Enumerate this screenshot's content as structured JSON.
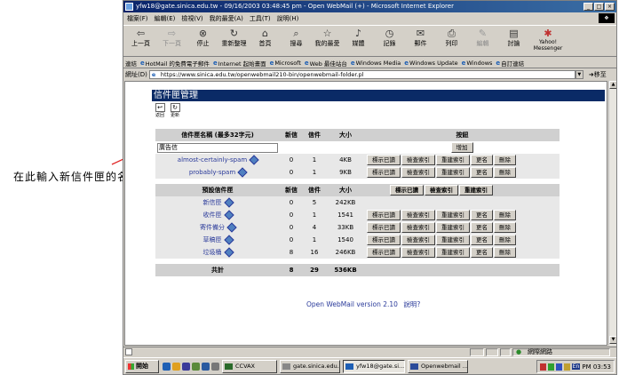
{
  "window": {
    "title": "yfw18@gate.sinica.edu.tw - 09/16/2003 03:48:45 pm - Open WebMail (+) - Microsoft Internet Explorer",
    "buttons": [
      "_",
      "□",
      "×"
    ]
  },
  "menu": [
    "檔案(F)",
    "編輯(E)",
    "檢視(V)",
    "我的最愛(A)",
    "工具(T)",
    "說明(H)"
  ],
  "toolbar": [
    {
      "label": "上一頁",
      "icon": "back-icon"
    },
    {
      "label": "下一頁",
      "icon": "forward-icon"
    },
    {
      "label": "停止",
      "icon": "stop-icon"
    },
    {
      "label": "重新整理",
      "icon": "refresh-icon"
    },
    {
      "label": "首頁",
      "icon": "home-icon"
    },
    {
      "label": "搜尋",
      "icon": "search-icon"
    },
    {
      "label": "我的最愛",
      "icon": "favorites-icon"
    },
    {
      "label": "媒體",
      "icon": "media-icon"
    },
    {
      "label": "記錄",
      "icon": "history-icon"
    },
    {
      "label": "郵件",
      "icon": "mail-icon"
    },
    {
      "label": "列印",
      "icon": "print-icon"
    },
    {
      "label": "編輯",
      "icon": "edit-icon"
    },
    {
      "label": "討論",
      "icon": "discuss-icon"
    },
    {
      "label": "Yahoo! Messenger",
      "icon": "messenger-icon"
    }
  ],
  "links_bar": {
    "label": "連結",
    "items": [
      "HotMail 的免費電子郵件",
      "Internet 起始畫面",
      "Microsoft",
      "Web 最佳站台",
      "Windows Media",
      "Windows Update",
      "Windows",
      "自訂連結"
    ]
  },
  "address": {
    "label": "網址(D)",
    "url": "https://www.sinica.edu.tw/openwebmail210-bin/openwebmail-folder.pl",
    "go": "移至"
  },
  "page": {
    "header": "信件匣管理",
    "icon_buttons": [
      {
        "label": "返回"
      },
      {
        "label": "更新"
      }
    ],
    "user_table": {
      "headers": {
        "name": "信件匣名稱 (最多32字元)",
        "new": "新信",
        "total": "信件",
        "size": "大小",
        "actions": "按鈕"
      },
      "new_name_value": "廣告信",
      "add_label": "增加",
      "rows": [
        {
          "name": "almost-certainly-spam",
          "new": "0",
          "total": "1",
          "size": "4KB"
        },
        {
          "name": "probably-spam",
          "new": "0",
          "total": "1",
          "size": "9KB"
        }
      ]
    },
    "default_table": {
      "headers": {
        "name": "預設信件匣",
        "new": "新信",
        "total": "信件",
        "size": "大小"
      },
      "header_actions": [
        "標示已讀",
        "檢查索引",
        "重建索引"
      ],
      "rows": [
        {
          "name": "新信匣",
          "new": "0",
          "total": "5",
          "size": "242KB"
        },
        {
          "name": "收件匣",
          "new": "0",
          "total": "1",
          "size": "1541"
        },
        {
          "name": "寄件備分",
          "new": "0",
          "total": "4",
          "size": "33KB"
        },
        {
          "name": "草稿匣",
          "new": "0",
          "total": "1",
          "size": "1540"
        },
        {
          "name": "垃圾桶",
          "new": "8",
          "total": "16",
          "size": "246KB"
        }
      ]
    },
    "row_actions": [
      "標示已讀",
      "檢查索引",
      "重建索引",
      "更名",
      "刪除"
    ],
    "total": {
      "label": "共計",
      "new": "8",
      "total": "29",
      "size": "536KB"
    },
    "footer": {
      "version": "Open WebMail version 2.10",
      "help": "說明?"
    }
  },
  "annotation": "在此輸入新信件匣的名稱",
  "status": {
    "zone": "網際網路"
  },
  "taskbar": {
    "start": "開始",
    "tasks": [
      "CCVAX",
      "gate.sinica.edu...",
      "yfw18@gate.si...",
      "Openwebmail ..."
    ],
    "clock": "PM 03:53",
    "lang": "En"
  }
}
